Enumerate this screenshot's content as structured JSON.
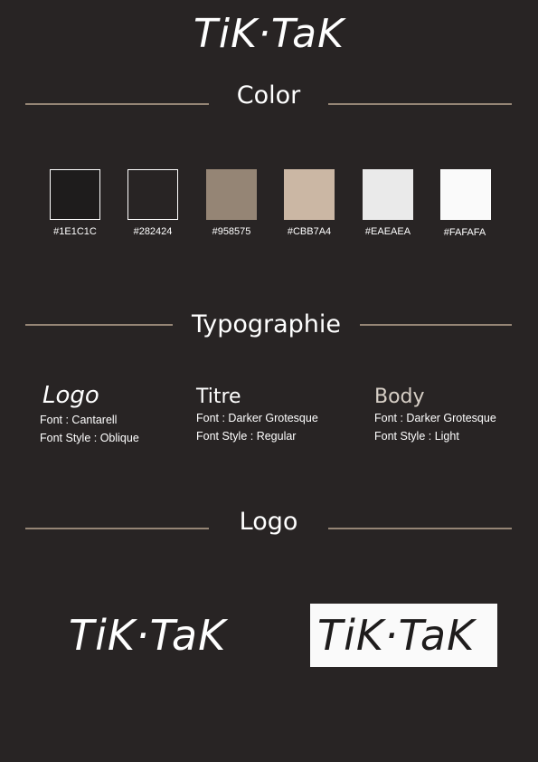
{
  "header": {
    "logo_text": "TiK·TaK"
  },
  "sections": {
    "color": "Color",
    "typography": "Typographie",
    "logo": "Logo"
  },
  "colors": [
    {
      "hex": "#1E1C1C",
      "label": "#1E1C1C",
      "bordered": true
    },
    {
      "hex": "#282424",
      "label": "#282424",
      "bordered": true
    },
    {
      "hex": "#958575",
      "label": "#958575",
      "bordered": false
    },
    {
      "hex": "#CBB7A4",
      "label": "#CBB7A4",
      "bordered": false
    },
    {
      "hex": "#EAEAEA",
      "label": "#EAEAEA",
      "bordered": false
    },
    {
      "hex": "#FAFAFA",
      "label": "#FAFAFA",
      "bordered": true
    }
  ],
  "typography": [
    {
      "name": "Logo",
      "font": "Font : Cantarell",
      "style": "Font Style : Oblique"
    },
    {
      "name": "Titre",
      "font": "Font : Darker Grotesque",
      "style": "Font Style : Regular"
    },
    {
      "name": "Body",
      "font": "Font : Darker Grotesque",
      "style": "Font Style : Light"
    }
  ],
  "logos": {
    "dark_variant": "TiK·TaK",
    "light_variant": "TiK·TaK"
  },
  "accent_rule_color": "#958575"
}
